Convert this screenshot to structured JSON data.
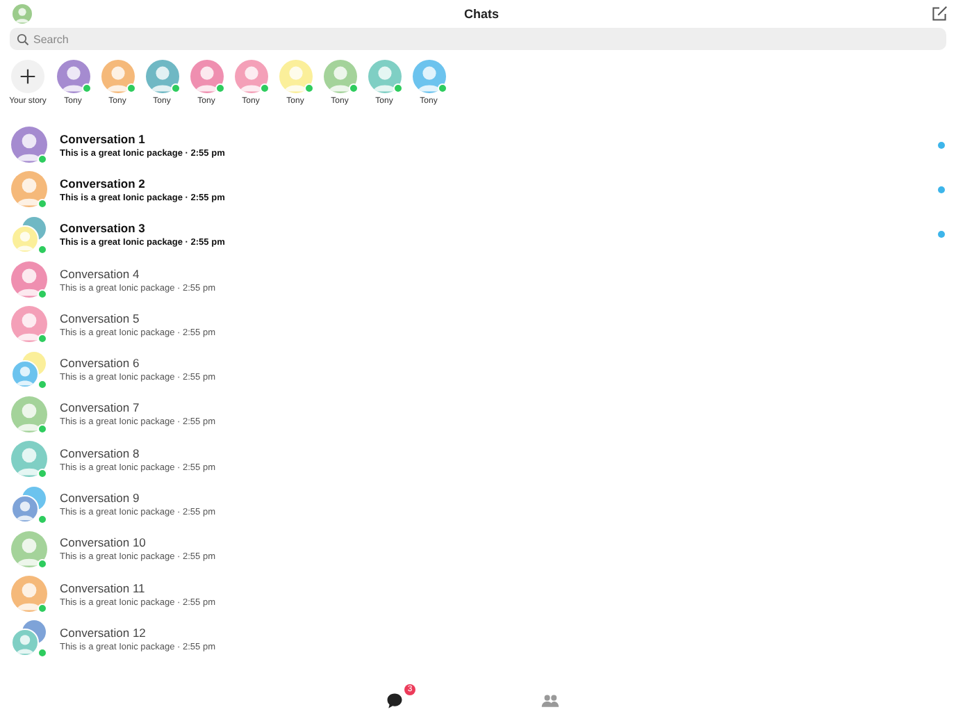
{
  "header": {
    "title": "Chats"
  },
  "search": {
    "placeholder": "Search"
  },
  "stories": {
    "add_label": "Your story",
    "items": [
      {
        "name": "Tony",
        "color": "#a58bd0",
        "online": true
      },
      {
        "name": "Tony",
        "color": "#f5b97a",
        "online": true
      },
      {
        "name": "Tony",
        "color": "#6fb8c4",
        "online": true
      },
      {
        "name": "Tony",
        "color": "#ef8fb0",
        "online": true
      },
      {
        "name": "Tony",
        "color": "#f4a0b8",
        "online": true
      },
      {
        "name": "Tony",
        "color": "#fbef9a",
        "online": true
      },
      {
        "name": "Tony",
        "color": "#a4d39a",
        "online": true
      },
      {
        "name": "Tony",
        "color": "#7fcfc4",
        "online": true
      },
      {
        "name": "Tony",
        "color": "#6cc3ee",
        "online": true
      }
    ]
  },
  "conversations": [
    {
      "name": "Conversation 1",
      "message": "This is a great Ionic package · 2:55 pm",
      "unread": true,
      "online": true,
      "kind": "single",
      "avatars": [
        {
          "color": "#a58bd0"
        }
      ]
    },
    {
      "name": "Conversation 2",
      "message": "This is a great Ionic package · 2:55 pm",
      "unread": true,
      "online": true,
      "kind": "single",
      "avatars": [
        {
          "color": "#f5b97a"
        }
      ]
    },
    {
      "name": "Conversation 3",
      "message": "This is a great Ionic package · 2:55 pm",
      "unread": true,
      "online": true,
      "kind": "group",
      "avatars": [
        {
          "color": "#6fb8c4"
        },
        {
          "color": "#fbef9a"
        }
      ]
    },
    {
      "name": "Conversation 4",
      "message": "This is a great Ionic package · 2:55 pm",
      "unread": false,
      "online": true,
      "kind": "single",
      "avatars": [
        {
          "color": "#ef8fb0"
        }
      ]
    },
    {
      "name": "Conversation 5",
      "message": "This is a great Ionic package · 2:55 pm",
      "unread": false,
      "online": true,
      "kind": "single",
      "avatars": [
        {
          "color": "#f4a0b8"
        }
      ]
    },
    {
      "name": "Conversation 6",
      "message": "This is a great Ionic package · 2:55 pm",
      "unread": false,
      "online": true,
      "kind": "group",
      "avatars": [
        {
          "color": "#fbef9a"
        },
        {
          "color": "#6cc3ee"
        }
      ]
    },
    {
      "name": "Conversation 7",
      "message": "This is a great Ionic package · 2:55 pm",
      "unread": false,
      "online": true,
      "kind": "single",
      "avatars": [
        {
          "color": "#a4d39a"
        }
      ]
    },
    {
      "name": "Conversation 8",
      "message": "This is a great Ionic package · 2:55 pm",
      "unread": false,
      "online": true,
      "kind": "single",
      "avatars": [
        {
          "color": "#7fcfc4"
        }
      ]
    },
    {
      "name": "Conversation 9",
      "message": "This is a great Ionic package · 2:55 pm",
      "unread": false,
      "online": true,
      "kind": "group",
      "avatars": [
        {
          "color": "#6cc3ee"
        },
        {
          "color": "#7ea3d8"
        }
      ]
    },
    {
      "name": "Conversation 10",
      "message": "This is a great Ionic package · 2:55 pm",
      "unread": false,
      "online": true,
      "kind": "single",
      "avatars": [
        {
          "color": "#a4d39a"
        }
      ]
    },
    {
      "name": "Conversation 11",
      "message": "This is a great Ionic package · 2:55 pm",
      "unread": false,
      "online": true,
      "kind": "single",
      "avatars": [
        {
          "color": "#f5b97a"
        }
      ]
    },
    {
      "name": "Conversation 12",
      "message": "This is a great Ionic package · 2:55 pm",
      "unread": false,
      "online": true,
      "kind": "group",
      "avatars": [
        {
          "color": "#7ea3d8"
        },
        {
          "color": "#7fcfc4"
        }
      ]
    }
  ],
  "tab_bar": {
    "items": [
      {
        "kind": "chats",
        "badge": "3",
        "selected": true
      },
      {
        "kind": "people",
        "selected": false
      }
    ]
  }
}
